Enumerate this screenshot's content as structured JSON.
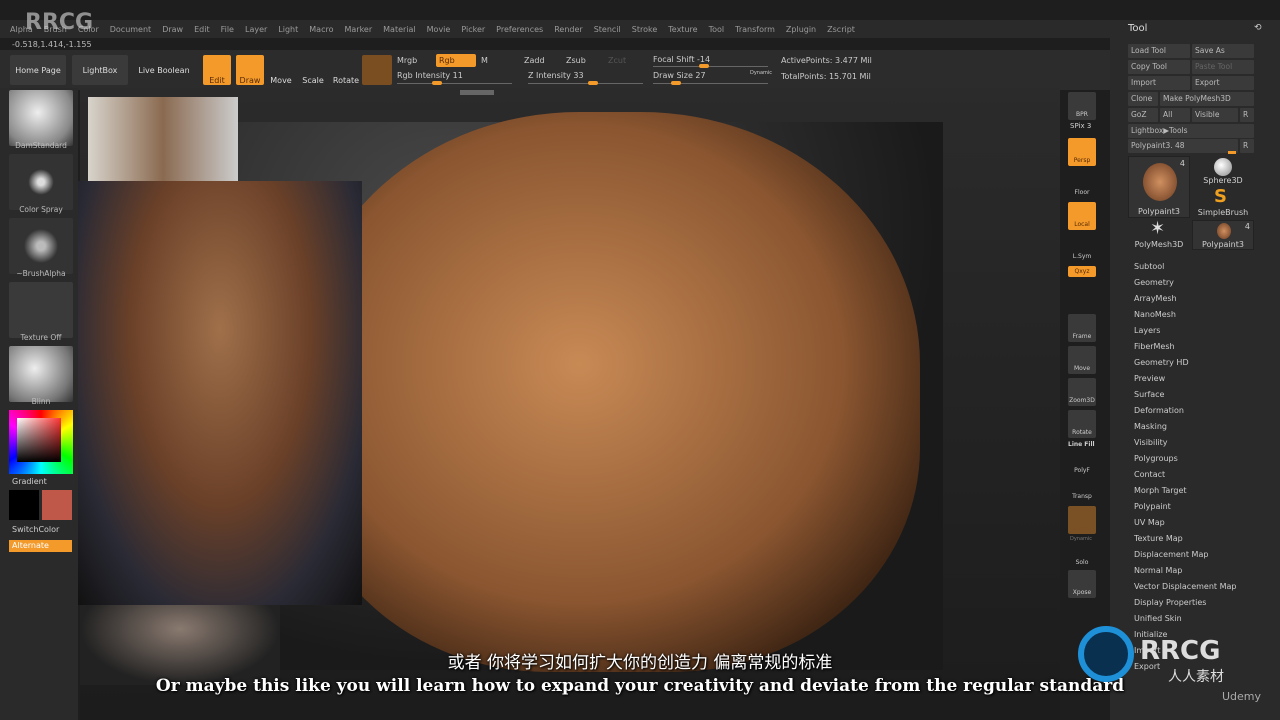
{
  "watermark": "RRCG",
  "menu": [
    "Alpha",
    "Brush",
    "Color",
    "Document",
    "Draw",
    "Edit",
    "File",
    "Layer",
    "Light",
    "Macro",
    "Marker",
    "Material",
    "Movie",
    "Picker",
    "Preferences",
    "Render",
    "Stencil",
    "Stroke",
    "Texture",
    "Tool",
    "Transform",
    "Zplugin",
    "Zscript"
  ],
  "coords": "-0.518,1.414,-1.155",
  "toolbar": {
    "home": "Home Page",
    "lightbox": "LightBox",
    "live_boolean": "Live Boolean",
    "edit": "Edit",
    "draw": "Draw",
    "move": "Move",
    "scale": "Scale",
    "rotate": "Rotate",
    "mrgb": "Mrgb",
    "rgb": "Rgb",
    "m": "M",
    "zadd": "Zadd",
    "zsub": "Zsub",
    "zcut": "Zcut",
    "rgb_intensity": "Rgb Intensity 11",
    "z_intensity": "Z Intensity 33",
    "focal_shift": "Focal Shift -14",
    "draw_size": "Draw Size 27",
    "dynamic": "Dynamic",
    "active_points": "ActivePoints: 3.477 Mil",
    "total_points": "TotalPoints: 15.701 Mil",
    "rgb_intensity_val": 11,
    "z_intensity_val": 33,
    "focal_shift_val": -14,
    "draw_size_val": 27
  },
  "left": {
    "brush": "DamStandard",
    "stroke": "Color Spray",
    "alpha": "~BrushAlpha",
    "texture": "Texture Off",
    "material": "Blinn",
    "gradient": "Gradient",
    "switch": "SwitchColor",
    "alternate": "Alternate",
    "main_color": "#c0584a",
    "secondary_color": "#000000"
  },
  "shelf": {
    "bpr": "BPR",
    "spix": "SPix 3",
    "persp": "Persp",
    "floor": "Floor",
    "local": "Local",
    "lsym": "L.Sym",
    "xyz": "Qxyz",
    "frame": "Frame",
    "move": "Move",
    "zoom": "Zoom3D",
    "rotate": "Rotate",
    "linefill": "Line Fill",
    "polyf": "PolyF",
    "transp": "Transp",
    "ghost": "Ghost",
    "dynamic": "Dynamic",
    "solo": "Solo",
    "xpose": "Xpose"
  },
  "tool": {
    "title": "Tool",
    "load": "Load Tool",
    "save_as": "Save As",
    "copy": "Copy Tool",
    "paste": "Paste Tool",
    "import": "Import",
    "export": "Export",
    "clone": "Clone",
    "make_polymesh": "Make PolyMesh3D",
    "goz": "GoZ",
    "all": "All",
    "visible": "Visible",
    "r": "R",
    "lightbox_tools": "Lightbox▶Tools",
    "polypaint_slider": "Polypaint3. 48",
    "thumbs": [
      {
        "label": "Polypaint3",
        "count": "4"
      },
      {
        "label": "Sphere3D"
      },
      {
        "label": "SimpleBrush"
      },
      {
        "label": "PolyMesh3D"
      },
      {
        "label": "Polypaint3",
        "count": "4"
      }
    ],
    "subpalettes": [
      "Subtool",
      "Geometry",
      "ArrayMesh",
      "NanoMesh",
      "Layers",
      "FiberMesh",
      "Geometry HD",
      "Preview",
      "Surface",
      "Deformation",
      "Masking",
      "Visibility",
      "Polygroups",
      "Contact",
      "Morph Target",
      "Polypaint",
      "UV Map",
      "Texture Map",
      "Displacement Map",
      "Normal Map",
      "Vector Displacement Map",
      "Display Properties",
      "Unified Skin",
      "Initialize",
      "Import",
      "Export"
    ]
  },
  "subtitles": {
    "zh": "或者 你将学习如何扩大你的创造力 偏离常规的标准",
    "en": "Or maybe this like you will learn how to expand your creativity and deviate from the regular standard"
  },
  "logo": {
    "text": "RRCG",
    "sub": "人人素材",
    "udemy": "Udemy"
  }
}
